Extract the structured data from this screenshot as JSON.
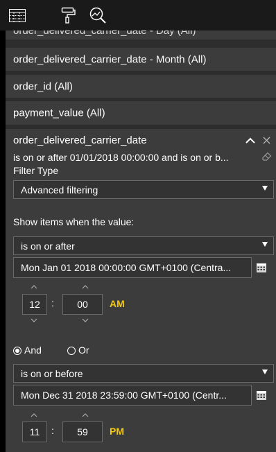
{
  "toolbar": {
    "icons": [
      "filter-pane-icon",
      "format-paintroller-icon",
      "analytics-magnifier-icon"
    ]
  },
  "filters": {
    "partial_card_label": "order_delivered_carrier_date - Day (All)",
    "cards": [
      "order_delivered_carrier_date - Month  (All)",
      "order_id  (All)",
      "payment_value  (All)"
    ]
  },
  "expanded_filter": {
    "title": "order_delivered_carrier_date",
    "summary": "is on or after 01/01/2018 00:00:00 and is on or b...",
    "filter_type_label": "Filter Type",
    "filter_type_value": "Advanced filtering",
    "show_items_label": "Show items when the value:",
    "condition1": {
      "operator": "is on or after",
      "date_value": "Mon Jan 01 2018 00:00:00 GMT+0100 (Centra...",
      "hour": "12",
      "minute": "00",
      "ampm": "AM"
    },
    "logic": {
      "and_label": "And",
      "or_label": "Or",
      "selected": "And"
    },
    "condition2": {
      "operator": "is on or before",
      "date_value": "Mon Dec 31 2018 23:59:00 GMT+0100 (Centr...",
      "hour": "11",
      "minute": "59",
      "ampm": "PM"
    },
    "colon": ":"
  },
  "colors": {
    "background": "#000000",
    "panel": "#2d2d2d",
    "card": "#3c3c3c",
    "input": "#333333",
    "accent": "#f2c811"
  }
}
